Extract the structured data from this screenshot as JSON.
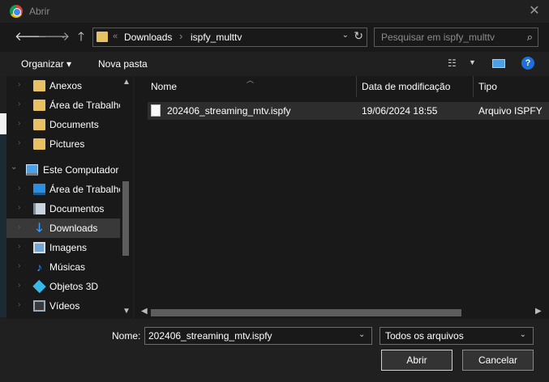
{
  "window": {
    "title": "Abrir",
    "close_glyph": "✕"
  },
  "nav": {
    "back": "🡐",
    "forward": "🡒",
    "up": "🡑",
    "recent": "⌄",
    "address": {
      "sep": "«",
      "crumbs": [
        "Downloads",
        "ispfy_multtv"
      ],
      "crumb_sep": "›",
      "dropdown": "⌄",
      "refresh": "↻"
    },
    "search": {
      "placeholder": "Pesquisar em ispfy_multtv",
      "icon": "⌕"
    }
  },
  "toolbar": {
    "organize": "Organizar ▾",
    "new_folder": "Nova pasta",
    "view_glyph": "☷",
    "view_dd": "▼",
    "help": "?"
  },
  "sidebar": {
    "items": [
      {
        "label": "Anexos",
        "icon": "folder"
      },
      {
        "label": "Área de Trabalho",
        "icon": "folder"
      },
      {
        "label": "Documents",
        "icon": "folder"
      },
      {
        "label": "Pictures",
        "icon": "folder"
      },
      {
        "label": "Este Computador",
        "icon": "pc"
      },
      {
        "label": "Área de Trabalho",
        "icon": "desktop"
      },
      {
        "label": "Documentos",
        "icon": "docs"
      },
      {
        "label": "Downloads",
        "icon": "down",
        "selected": true
      },
      {
        "label": "Imagens",
        "icon": "img"
      },
      {
        "label": "Músicas",
        "icon": "music"
      },
      {
        "label": "Objetos 3D",
        "icon": "3d"
      },
      {
        "label": "Vídeos",
        "icon": "vid"
      }
    ],
    "chevron": "›",
    "chevron_open": "⌄",
    "down_glyph": "🡓",
    "music_glyph": "♪",
    "scroll_up": "▲",
    "scroll_down": "▼"
  },
  "files": {
    "sort_glyph": "︿",
    "columns": [
      "Nome",
      "Data de modificação",
      "Tipo"
    ],
    "rows": [
      {
        "name": "202406_streaming_mtv.ispfy",
        "modified": "19/06/2024 18:55",
        "type": "Arquivo ISPFY"
      }
    ],
    "scroll_left": "◀",
    "scroll_right": "▶"
  },
  "footer": {
    "name_label": "Nome:",
    "name_value": "202406_streaming_mtv.ispfy",
    "name_dd": "⌄",
    "type_value": "Todos os arquivos",
    "type_dd": "⌄",
    "open_button": "Abrir",
    "cancel_button": "Cancelar"
  }
}
